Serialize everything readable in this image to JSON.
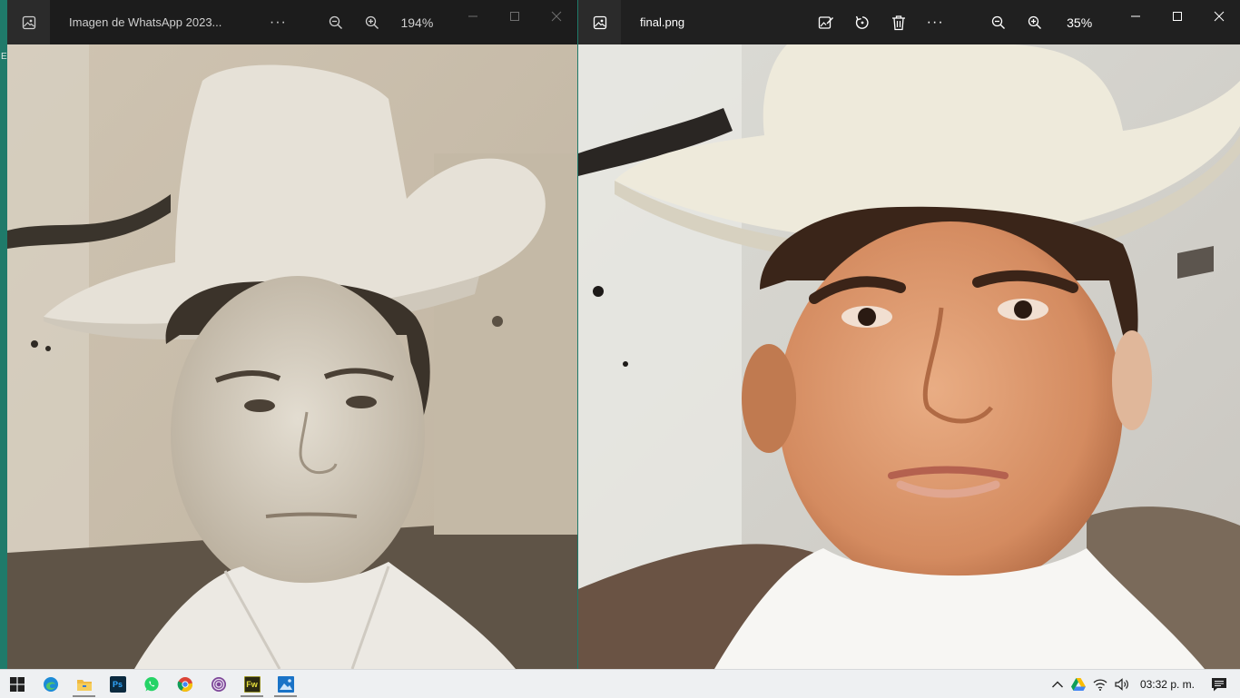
{
  "left_window": {
    "title": "Imagen de WhatsApp 2023...",
    "more_label": "···",
    "zoom_level": "194%"
  },
  "right_window": {
    "title": "final.png",
    "more_label": "···",
    "zoom_level": "35%"
  },
  "desktop": {
    "edge_glyph": "E"
  },
  "taskbar": {
    "apps": [
      {
        "icon": "windows-start-icon"
      },
      {
        "icon": "edge-icon"
      },
      {
        "icon": "file-explorer-icon"
      },
      {
        "icon": "photoshop-icon",
        "label": "Ps"
      },
      {
        "icon": "whatsapp-icon"
      },
      {
        "icon": "chrome-icon"
      },
      {
        "icon": "tor-browser-icon"
      },
      {
        "icon": "fireworks-icon",
        "label": "Fw"
      },
      {
        "icon": "photos-icon"
      }
    ],
    "clock": "03:32 p. m."
  },
  "colors": {
    "desktop_bg": "#1f7a6a",
    "titlebar": "#202020",
    "taskbar": "#eef0f2"
  }
}
